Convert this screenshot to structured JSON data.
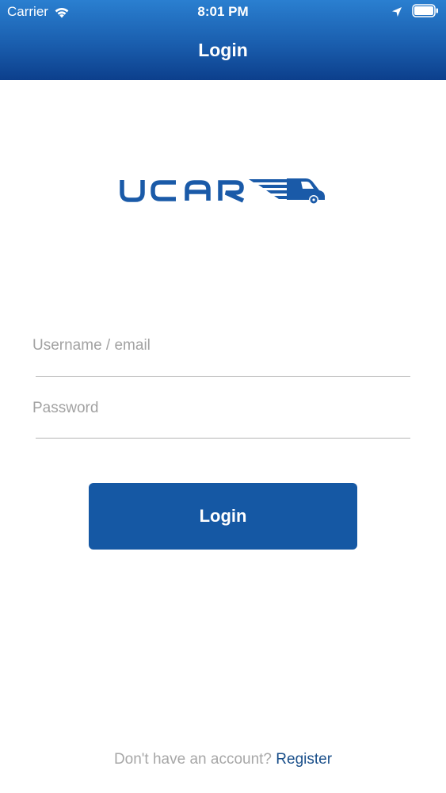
{
  "status_bar": {
    "carrier": "Carrier",
    "time": "8:01 PM",
    "icons": [
      "wifi-icon",
      "location-icon",
      "battery-icon"
    ]
  },
  "nav": {
    "title": "Login"
  },
  "logo": {
    "text": "UCAR",
    "brand_color": "#1a5aa8"
  },
  "form": {
    "username": {
      "placeholder": "Username / email",
      "value": ""
    },
    "password": {
      "placeholder": "Password",
      "value": ""
    },
    "login_button_label": "Login"
  },
  "footer": {
    "prompt": "Don't have an account?",
    "register_label": "Register"
  },
  "colors": {
    "header_top": "#2a7fd0",
    "header_bottom": "#0c3f8c",
    "button": "#1558a4",
    "link": "#1a4f8a",
    "placeholder": "#a2a2a2"
  }
}
